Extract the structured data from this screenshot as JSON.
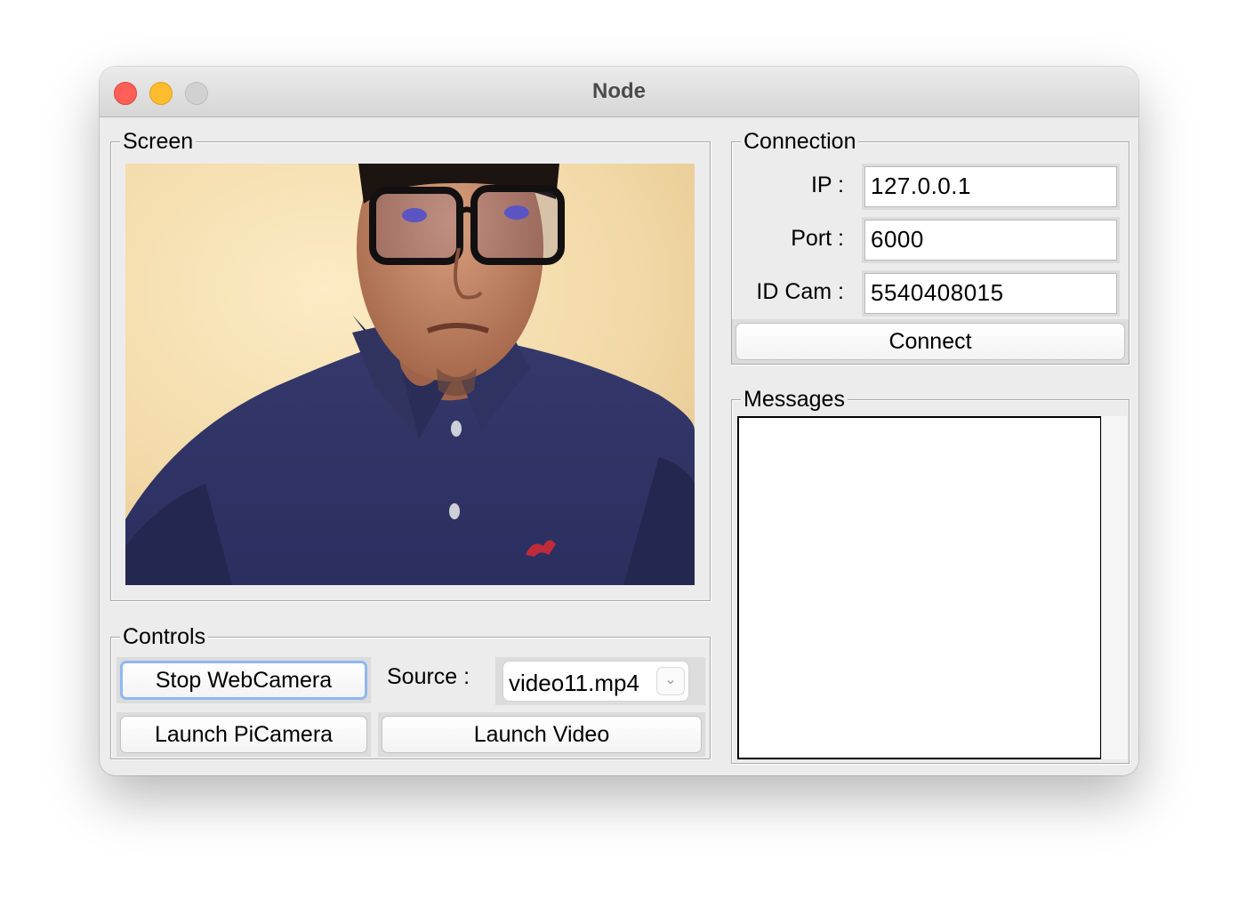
{
  "window": {
    "title": "Node"
  },
  "screen": {
    "label": "Screen"
  },
  "connection": {
    "label": "Connection",
    "ip_label": "IP :",
    "ip_value": "127.0.0.1",
    "port_label": "Port :",
    "port_value": "6000",
    "idcam_label": "ID Cam :",
    "idcam_value": "5540408015",
    "connect_button": "Connect"
  },
  "messages": {
    "label": "Messages"
  },
  "controls": {
    "label": "Controls",
    "stop_webcam_button": "Stop WebCamera",
    "source_label": "Source :",
    "source_selected": "video11.mp4",
    "launch_picamera_button": "Launch PiCamera",
    "launch_video_button": "Launch Video"
  }
}
